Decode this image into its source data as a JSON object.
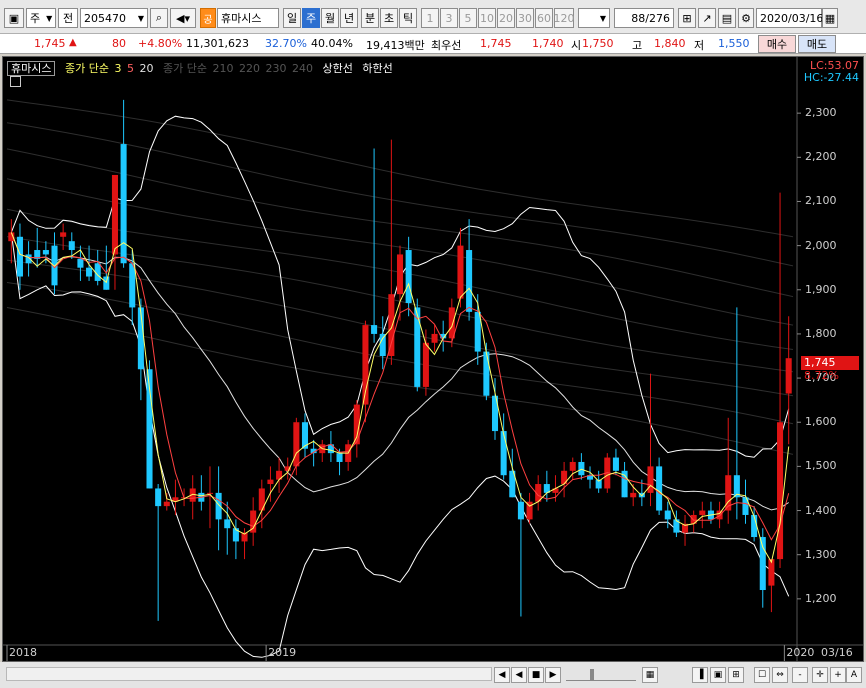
{
  "toolbar": {
    "market": "주",
    "type": "전",
    "code": "205470",
    "badge": "공",
    "stock_name": "휴마시스",
    "periods": [
      "일",
      "주",
      "월",
      "년",
      "분",
      "초",
      "틱"
    ],
    "selected_period": "주",
    "intervals": [
      "1",
      "3",
      "5",
      "10",
      "20",
      "30",
      "60",
      "120"
    ],
    "counter": "88",
    "counter_total": "/276",
    "date": "2020/03/16"
  },
  "quote": {
    "price": "1,745",
    "change_arrow": "▲",
    "change": "80",
    "change_pct": "+4.80%",
    "volume": "11,301,623",
    "vol_pct1": "32.70%",
    "vol_pct2": "40.04%",
    "amount": "19,413백만",
    "best_label": "최우선",
    "ask": "1,745",
    "bid": "1,740",
    "open_label": "시",
    "open": "1,750",
    "high_label": "고",
    "high": "1,840",
    "low_label": "저",
    "low": "1,550",
    "buy_label": "매수",
    "sell_label": "매도"
  },
  "chart": {
    "legend_title": "휴마시스",
    "legend_ma": "종가 단순",
    "legend_periods": [
      "3",
      "5",
      "20"
    ],
    "legend_ma2": "종가 단순",
    "legend_periods2": [
      "210",
      "220",
      "230",
      "240"
    ],
    "legend_upper": "상한선",
    "legend_lower": "하한선",
    "lc_label": "LC:53.07",
    "hc_label": "HC:-27.44",
    "last_price_tag": "1,745",
    "last_pct_tag": "8.72%",
    "date_end": "03/16"
  },
  "chart_data": {
    "type": "candlestick",
    "y_ticks": [
      "2,300",
      "2,200",
      "2,100",
      "2,000",
      "1,900",
      "1,800",
      "1,700",
      "1,600",
      "1,500",
      "1,400",
      "1,300",
      "1,200"
    ],
    "y_tick_values": [
      2300,
      2200,
      2100,
      2000,
      1900,
      1800,
      1700,
      1600,
      1500,
      1400,
      1300,
      1200
    ],
    "x_labels": [
      "2018",
      "2019",
      "2020"
    ],
    "ylim": [
      1100,
      2400
    ],
    "colors": {
      "up": "#e01414",
      "down": "#1ec8ff",
      "band": "#ffffff",
      "ma3": "#ff4040",
      "ma5": "#ffff66",
      "ma20": "#e0e0e0"
    },
    "candles": [
      {
        "o": 2010,
        "h": 2060,
        "l": 1960,
        "c": 2030
      },
      {
        "o": 2020,
        "h": 2050,
        "l": 1900,
        "c": 1930
      },
      {
        "o": 1980,
        "h": 2010,
        "l": 1930,
        "c": 1960
      },
      {
        "o": 1990,
        "h": 2040,
        "l": 1950,
        "c": 1970
      },
      {
        "o": 1990,
        "h": 2010,
        "l": 1960,
        "c": 1980
      },
      {
        "o": 2000,
        "h": 2030,
        "l": 1890,
        "c": 1910
      },
      {
        "o": 2020,
        "h": 2050,
        "l": 1990,
        "c": 2030
      },
      {
        "o": 2010,
        "h": 2030,
        "l": 1970,
        "c": 1990
      },
      {
        "o": 1970,
        "h": 2000,
        "l": 1920,
        "c": 1950
      },
      {
        "o": 1950,
        "h": 2000,
        "l": 1920,
        "c": 1930
      },
      {
        "o": 1960,
        "h": 1990,
        "l": 1910,
        "c": 1920
      },
      {
        "o": 1930,
        "h": 2000,
        "l": 1900,
        "c": 1900
      },
      {
        "o": 1980,
        "h": 2160,
        "l": 1900,
        "c": 2160
      },
      {
        "o": 2230,
        "h": 2330,
        "l": 1950,
        "c": 1960
      },
      {
        "o": 1960,
        "h": 1990,
        "l": 1820,
        "c": 1860
      },
      {
        "o": 1860,
        "h": 1880,
        "l": 1650,
        "c": 1720
      },
      {
        "o": 1720,
        "h": 1740,
        "l": 1450,
        "c": 1450
      },
      {
        "o": 1450,
        "h": 1460,
        "l": 1150,
        "c": 1410
      },
      {
        "o": 1410,
        "h": 1440,
        "l": 1400,
        "c": 1420
      },
      {
        "o": 1420,
        "h": 1470,
        "l": 1390,
        "c": 1430
      },
      {
        "o": 1430,
        "h": 1450,
        "l": 1410,
        "c": 1430
      },
      {
        "o": 1420,
        "h": 1480,
        "l": 1380,
        "c": 1450
      },
      {
        "o": 1440,
        "h": 1480,
        "l": 1400,
        "c": 1420
      },
      {
        "o": 1440,
        "h": 1500,
        "l": 1360,
        "c": 1440
      },
      {
        "o": 1440,
        "h": 1500,
        "l": 1310,
        "c": 1380
      },
      {
        "o": 1380,
        "h": 1420,
        "l": 1300,
        "c": 1360
      },
      {
        "o": 1360,
        "h": 1380,
        "l": 1290,
        "c": 1330
      },
      {
        "o": 1330,
        "h": 1360,
        "l": 1290,
        "c": 1350
      },
      {
        "o": 1350,
        "h": 1430,
        "l": 1320,
        "c": 1400
      },
      {
        "o": 1400,
        "h": 1470,
        "l": 1360,
        "c": 1450
      },
      {
        "o": 1460,
        "h": 1500,
        "l": 1420,
        "c": 1470
      },
      {
        "o": 1470,
        "h": 1520,
        "l": 1440,
        "c": 1490
      },
      {
        "o": 1490,
        "h": 1520,
        "l": 1470,
        "c": 1500
      },
      {
        "o": 1500,
        "h": 1610,
        "l": 1480,
        "c": 1600
      },
      {
        "o": 1600,
        "h": 1620,
        "l": 1520,
        "c": 1540
      },
      {
        "o": 1540,
        "h": 1560,
        "l": 1500,
        "c": 1530
      },
      {
        "o": 1530,
        "h": 1560,
        "l": 1510,
        "c": 1550
      },
      {
        "o": 1550,
        "h": 1580,
        "l": 1510,
        "c": 1530
      },
      {
        "o": 1530,
        "h": 1540,
        "l": 1480,
        "c": 1510
      },
      {
        "o": 1510,
        "h": 1560,
        "l": 1490,
        "c": 1550
      },
      {
        "o": 1550,
        "h": 1650,
        "l": 1520,
        "c": 1640
      },
      {
        "o": 1640,
        "h": 1830,
        "l": 1600,
        "c": 1820
      },
      {
        "o": 1820,
        "h": 2220,
        "l": 1780,
        "c": 1800
      },
      {
        "o": 1800,
        "h": 1840,
        "l": 1720,
        "c": 1750
      },
      {
        "o": 1750,
        "h": 2240,
        "l": 1730,
        "c": 1890
      },
      {
        "o": 1890,
        "h": 2000,
        "l": 1830,
        "c": 1980
      },
      {
        "o": 1990,
        "h": 2020,
        "l": 1840,
        "c": 1870
      },
      {
        "o": 1860,
        "h": 1880,
        "l": 1670,
        "c": 1680
      },
      {
        "o": 1680,
        "h": 1810,
        "l": 1660,
        "c": 1780
      },
      {
        "o": 1780,
        "h": 1820,
        "l": 1760,
        "c": 1800
      },
      {
        "o": 1800,
        "h": 1830,
        "l": 1760,
        "c": 1790
      },
      {
        "o": 1790,
        "h": 1880,
        "l": 1770,
        "c": 1860
      },
      {
        "o": 1880,
        "h": 2040,
        "l": 1860,
        "c": 2000
      },
      {
        "o": 1990,
        "h": 2060,
        "l": 1830,
        "c": 1850
      },
      {
        "o": 1850,
        "h": 1890,
        "l": 1730,
        "c": 1760
      },
      {
        "o": 1760,
        "h": 1780,
        "l": 1650,
        "c": 1660
      },
      {
        "o": 1660,
        "h": 1700,
        "l": 1560,
        "c": 1580
      },
      {
        "o": 1580,
        "h": 1620,
        "l": 1470,
        "c": 1480
      },
      {
        "o": 1490,
        "h": 1540,
        "l": 1430,
        "c": 1430
      },
      {
        "o": 1420,
        "h": 1440,
        "l": 1160,
        "c": 1380
      },
      {
        "o": 1380,
        "h": 1440,
        "l": 1370,
        "c": 1420
      },
      {
        "o": 1420,
        "h": 1480,
        "l": 1400,
        "c": 1460
      },
      {
        "o": 1460,
        "h": 1490,
        "l": 1420,
        "c": 1440
      },
      {
        "o": 1440,
        "h": 1480,
        "l": 1420,
        "c": 1450
      },
      {
        "o": 1460,
        "h": 1510,
        "l": 1430,
        "c": 1490
      },
      {
        "o": 1490,
        "h": 1520,
        "l": 1470,
        "c": 1510
      },
      {
        "o": 1510,
        "h": 1530,
        "l": 1470,
        "c": 1480
      },
      {
        "o": 1480,
        "h": 1500,
        "l": 1450,
        "c": 1470
      },
      {
        "o": 1470,
        "h": 1490,
        "l": 1440,
        "c": 1450
      },
      {
        "o": 1450,
        "h": 1530,
        "l": 1440,
        "c": 1520
      },
      {
        "o": 1520,
        "h": 1540,
        "l": 1480,
        "c": 1490
      },
      {
        "o": 1490,
        "h": 1510,
        "l": 1430,
        "c": 1430
      },
      {
        "o": 1430,
        "h": 1460,
        "l": 1410,
        "c": 1440
      },
      {
        "o": 1440,
        "h": 1470,
        "l": 1410,
        "c": 1430
      },
      {
        "o": 1440,
        "h": 1710,
        "l": 1410,
        "c": 1500
      },
      {
        "o": 1500,
        "h": 1520,
        "l": 1390,
        "c": 1400
      },
      {
        "o": 1400,
        "h": 1420,
        "l": 1360,
        "c": 1380
      },
      {
        "o": 1380,
        "h": 1400,
        "l": 1340,
        "c": 1350
      },
      {
        "o": 1350,
        "h": 1390,
        "l": 1320,
        "c": 1370
      },
      {
        "o": 1370,
        "h": 1400,
        "l": 1350,
        "c": 1390
      },
      {
        "o": 1390,
        "h": 1420,
        "l": 1360,
        "c": 1400
      },
      {
        "o": 1400,
        "h": 1420,
        "l": 1370,
        "c": 1380
      },
      {
        "o": 1380,
        "h": 1420,
        "l": 1360,
        "c": 1400
      },
      {
        "o": 1400,
        "h": 1610,
        "l": 1370,
        "c": 1480
      },
      {
        "o": 1480,
        "h": 1860,
        "l": 1380,
        "c": 1430
      },
      {
        "o": 1430,
        "h": 1470,
        "l": 1370,
        "c": 1390
      },
      {
        "o": 1390,
        "h": 1410,
        "l": 1330,
        "c": 1340
      },
      {
        "o": 1340,
        "h": 1360,
        "l": 1180,
        "c": 1220
      },
      {
        "o": 1230,
        "h": 1250,
        "l": 1170,
        "c": 1290
      },
      {
        "o": 1290,
        "h": 2120,
        "l": 1270,
        "c": 1600
      },
      {
        "o": 1665,
        "h": 1840,
        "l": 1550,
        "c": 1745
      }
    ]
  },
  "bottom": {
    "nav_buttons": [
      "◀",
      "▶",
      "■",
      "▶▶"
    ],
    "zoom_minus": "-",
    "zoom_plus": "+",
    "font_label": "A"
  }
}
